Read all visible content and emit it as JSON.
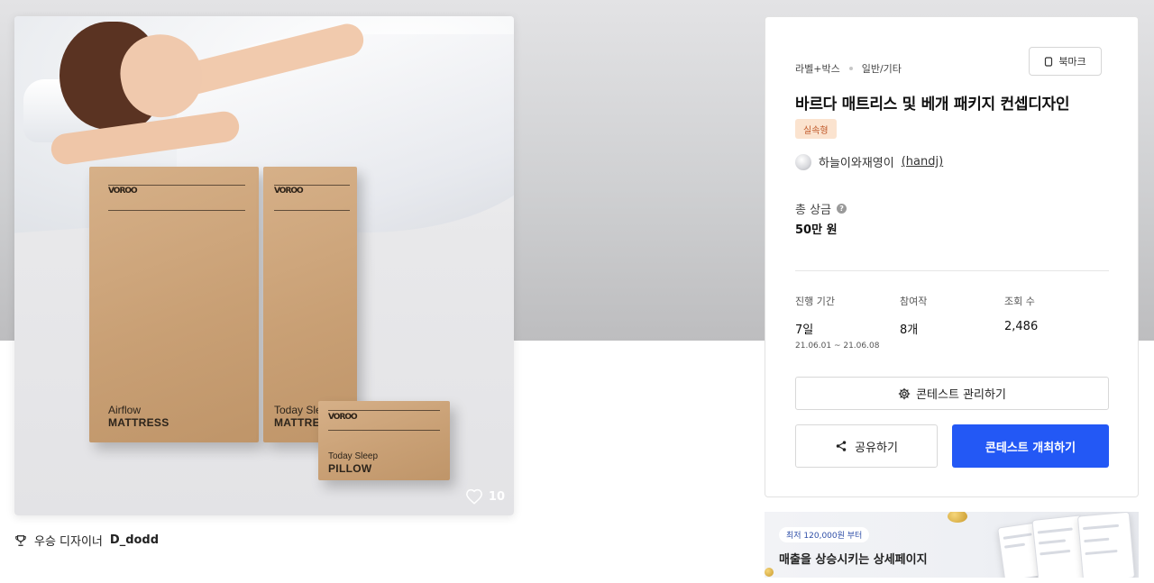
{
  "hero": {
    "image_alt": "바르다 매트리스 및 베개 패키지 디자인 이미지",
    "boxes": {
      "brand": "VOROO",
      "mattress1": {
        "line1": "Airflow",
        "line2": "MATTRESS"
      },
      "mattress2": {
        "line1": "Today Sleep",
        "line2": "MATTRESS"
      },
      "pillow": {
        "line1": "Today Sleep",
        "line2": "PILLOW"
      }
    },
    "like_count": "10"
  },
  "winner": {
    "label": "우승 디자이너",
    "name": "D_dodd"
  },
  "info": {
    "category_primary": "라벨+박스",
    "category_secondary": "일반/기타",
    "bookmark_label": "북마크",
    "title": "바르다 매트리스 및 베개 패키지 컨셉디자인",
    "badge": "실속형",
    "author_name": "하늘이와재영이",
    "author_handle": "(handj)",
    "prize_label": "총 상금",
    "prize_value": "50만 원",
    "stats": [
      {
        "label": "진행 기간",
        "value": "7일",
        "sub": "21.06.01 ~ 21.06.08"
      },
      {
        "label": "참여작",
        "value": "8개",
        "sub": ""
      },
      {
        "label": "조회 수",
        "value": "2,486",
        "sub": ""
      }
    ],
    "manage_label": "콘테스트 관리하기",
    "share_label": "공유하기",
    "host_label": "콘테스트 개최하기"
  },
  "ad": {
    "pill": "최저 120,000원 부터",
    "headline": "매출을 상승시키는 상세페이지"
  },
  "colors": {
    "primary": "#2358f5",
    "badge_bg": "#fbe3cf",
    "badge_text": "#c0592a",
    "kraft": "#c9a075"
  }
}
